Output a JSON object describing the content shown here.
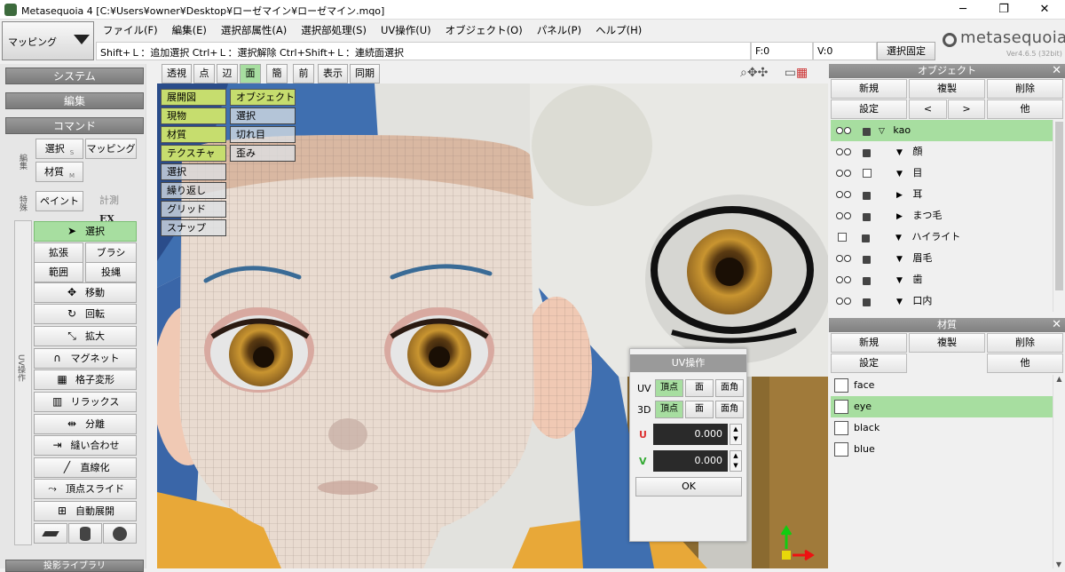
{
  "window": {
    "title": "Metasequoia 4 [C:¥Users¥owner¥Desktop¥ローゼマイン¥ローゼマイン.mqo]",
    "minimize": "─",
    "maximize": "❐",
    "close": "✕"
  },
  "mode_button": {
    "label": "マッピング"
  },
  "menu": [
    "ファイル(F)",
    "編集(E)",
    "選択部属性(A)",
    "選択部処理(S)",
    "UV操作(U)",
    "オブジェクト(O)",
    "パネル(P)",
    "ヘルプ(H)"
  ],
  "hint": "Shift+Ｌ：追加選択  Ctrl+Ｌ：選択解除  Ctrl+Shift+Ｌ：連続面選択",
  "status": {
    "faces": "F:0",
    "verts": "V:0",
    "select_fix": "選択固定"
  },
  "logo": {
    "name": "metasequoia4",
    "version": "Ver4.6.5 (32bit)"
  },
  "left": {
    "system_header": "システム",
    "edit_header": "編集",
    "command_header": "コマンド",
    "edit_side": "編集",
    "special_side": "特殊",
    "uv_side": "UV操作",
    "select_s": "選択",
    "select_s_key": "S",
    "mapping": "マッピング",
    "material_m": "材質",
    "material_m_key": "M",
    "paint": "ペイント",
    "measure": "計測",
    "ex": "EX",
    "tools": [
      {
        "label": "選択",
        "icon": "arrow"
      },
      {
        "label": "拡張",
        "label2": "ブラシ"
      },
      {
        "label": "範囲",
        "label2": "投縄"
      },
      {
        "label": "移動",
        "icon": "move"
      },
      {
        "label": "回転",
        "icon": "rotate"
      },
      {
        "label": "拡大",
        "icon": "scale"
      },
      {
        "label": "マグネット",
        "icon": "magnet"
      },
      {
        "label": "格子変形",
        "icon": "lattice"
      },
      {
        "label": "リラックス",
        "icon": "relax"
      },
      {
        "label": "分離",
        "icon": "separate"
      },
      {
        "label": "縫い合わせ",
        "icon": "stitch"
      },
      {
        "label": "直線化",
        "icon": "line"
      },
      {
        "label": "頂点スライド",
        "icon": "slide"
      },
      {
        "label": "自動展開",
        "icon": "unwrap"
      }
    ],
    "bottom_header": "投影ライブラリ"
  },
  "view_tabs": [
    "透視",
    "点",
    "辺",
    "面",
    "簡",
    "前",
    "表示",
    "同期"
  ],
  "view_tab_selected": "面",
  "overlay": {
    "col1": [
      "展開図",
      "現物",
      "材質",
      "テクスチャ",
      "選択",
      "繰り返し",
      "グリッド",
      "スナップ"
    ],
    "col2": [
      "オブジェクト",
      "選択",
      "切れ目",
      "歪み"
    ]
  },
  "objects_panel": {
    "title": "オブジェクト",
    "buttons": [
      "新規",
      "複製",
      "削除",
      "設定",
      "<",
      ">",
      "他"
    ],
    "rows": [
      {
        "name": "kao",
        "level": 0,
        "expand": "▽",
        "selected": true,
        "visible": true,
        "locked": true
      },
      {
        "name": "顔",
        "level": 1,
        "expand": "▼",
        "visible": true,
        "locked": true
      },
      {
        "name": "目",
        "level": 1,
        "expand": "▼",
        "visible": true,
        "locked": false
      },
      {
        "name": "耳",
        "level": 1,
        "expand": "▶",
        "visible": true,
        "locked": true
      },
      {
        "name": "まつ毛",
        "level": 1,
        "expand": "▶",
        "visible": true,
        "locked": true
      },
      {
        "name": "ハイライト",
        "level": 1,
        "expand": "▼",
        "visible": false,
        "locked": true
      },
      {
        "name": "眉毛",
        "level": 1,
        "expand": "▼",
        "visible": true,
        "locked": true
      },
      {
        "name": "歯",
        "level": 1,
        "expand": "▼",
        "visible": true,
        "locked": true
      },
      {
        "name": "口内",
        "level": 1,
        "expand": "▼",
        "visible": true,
        "locked": true
      }
    ]
  },
  "material_panel": {
    "title": "材質",
    "buttons": [
      "新規",
      "複製",
      "削除",
      "設定",
      "他"
    ],
    "items": [
      {
        "name": "face",
        "selected": false
      },
      {
        "name": "eye",
        "selected": true
      },
      {
        "name": "black",
        "selected": false
      },
      {
        "name": "blue",
        "selected": false
      }
    ]
  },
  "uv_dialog": {
    "title": "UV操作",
    "uv_label": "UV",
    "d3_label": "3D",
    "modes": [
      "頂点",
      "面",
      "面角"
    ],
    "u_label": "U",
    "v_label": "V",
    "u_value": "0.000",
    "v_value": "0.000",
    "ok": "OK"
  },
  "colors": {
    "accent_green": "#a7dea0",
    "overlay_green": "#c6dd6e",
    "u_red": "#d33",
    "v_green": "#3a3"
  }
}
